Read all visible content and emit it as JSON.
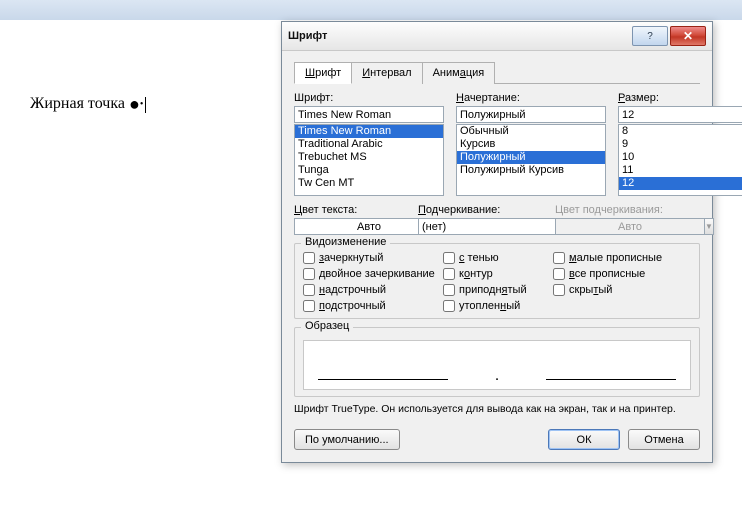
{
  "doc": {
    "line1": "Жирная точка"
  },
  "dialog": {
    "title": "Шрифт",
    "tabs": [
      "Шрифт",
      "Интервал",
      "Анимация"
    ],
    "labels": {
      "font": "Шрифт:",
      "style": "Начертание:",
      "size": "Размер:",
      "color": "Цвет текста:",
      "underline": "Подчеркивание:",
      "ulcolor": "Цвет подчеркивания:"
    },
    "font_input": "Times New Roman",
    "font_list": [
      "Times New Roman",
      "Traditional Arabic",
      "Trebuchet MS",
      "Tunga",
      "Tw Cen MT"
    ],
    "font_selected": "Times New Roman",
    "style_input": "Полужирный",
    "style_list": [
      "Обычный",
      "Курсив",
      "Полужирный",
      "Полужирный Курсив"
    ],
    "style_selected": "Полужирный",
    "size_input": "12",
    "size_list": [
      "8",
      "9",
      "10",
      "11",
      "12"
    ],
    "size_selected": "12",
    "color_value": "Авто",
    "underline_value": "(нет)",
    "ulcolor_value": "Авто",
    "effects": {
      "legend": "Видоизменение",
      "items": [
        "зачеркнутый",
        "с тенью",
        "малые прописные",
        "двойное зачеркивание",
        "контур",
        "все прописные",
        "надстрочный",
        "приподнятый",
        "скрытый",
        "подстрочный",
        "утопленный"
      ]
    },
    "sample_legend": "Образец",
    "sample_dot": ".",
    "hint": "Шрифт TrueType. Он используется для вывода как на экран, так и на принтер.",
    "buttons": {
      "default": "По умолчанию...",
      "ok": "ОК",
      "cancel": "Отмена"
    }
  }
}
